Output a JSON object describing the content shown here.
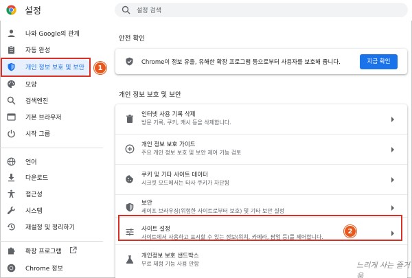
{
  "header": {
    "title": "설정",
    "search_placeholder": "설정 검색"
  },
  "sidebar": {
    "items": [
      {
        "label": "나와 Google의 관계",
        "icon": "person-icon"
      },
      {
        "label": "자동 완성",
        "icon": "clipboard-icon"
      },
      {
        "label": "개인 정보 보호 및 보안",
        "icon": "shield-icon",
        "active": true
      },
      {
        "label": "모양",
        "icon": "palette-icon"
      },
      {
        "label": "검색엔진",
        "icon": "search-icon"
      },
      {
        "label": "기본 브라우저",
        "icon": "browser-icon"
      },
      {
        "label": "시작 그룹",
        "icon": "power-icon"
      },
      {
        "label": "언어",
        "icon": "globe-icon"
      },
      {
        "label": "다운로드",
        "icon": "download-icon"
      },
      {
        "label": "접근성",
        "icon": "accessibility-icon"
      },
      {
        "label": "시스템",
        "icon": "wrench-icon"
      },
      {
        "label": "재설정 및 정리하기",
        "icon": "history-icon"
      },
      {
        "label": "확장 프로그램",
        "icon": "puzzle-icon"
      },
      {
        "label": "Chrome 정보",
        "icon": "chrome-icon"
      }
    ]
  },
  "main": {
    "safety_title": "안전 확인",
    "safety_text": "Chrome이 정보 유출, 유해한 확장 프로그램 등으로부터 사용자를 보호해 줍니다.",
    "safety_button": "지금 확인",
    "privacy_title": "개인 정보 보호 및 보안",
    "rows": [
      {
        "title": "인터넷 사용 기록 삭제",
        "sub": "방문 기록, 쿠키, 캐시 등을 삭제합니다.",
        "icon": "trash-icon"
      },
      {
        "title": "개인 정보 보호 가이드",
        "sub": "주요 개인 정보 보호 및 보안 제어 기능 검토",
        "icon": "add-circle-icon"
      },
      {
        "title": "쿠키 및 기타 사이트 데이터",
        "sub": "시크릿 모드에서는 타사 쿠키가 차단됨",
        "icon": "cookie-icon"
      },
      {
        "title": "보안",
        "sub": "세이프 브라우징(위험한 사이트로부터 보호) 및 기타 보안 설정",
        "icon": "shield-icon"
      },
      {
        "title": "사이트 설정",
        "sub": "사이트에서 사용하고 표시할 수 있는 정보(위치, 카메라, 팝업 등)를 제어합니다.",
        "icon": "sliders-icon"
      },
      {
        "title": "개인정보 보호 샌드박스",
        "sub": "무료 체험 기능 사용 안함",
        "icon": "flask-icon"
      }
    ]
  },
  "annotations": {
    "badge1": "1",
    "badge2": "2",
    "watermark": "느리게 사는 즐거움"
  },
  "colors": {
    "accent": "#1a73e8",
    "highlight": "#d93025",
    "badge": "#e8581c"
  }
}
